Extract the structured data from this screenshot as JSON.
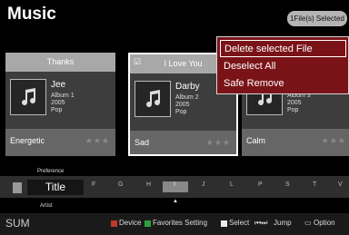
{
  "header": {
    "title": "Music",
    "selected_badge": "1File(s) Selected"
  },
  "cards": [
    {
      "header": "Thanks",
      "artist": "Jee",
      "album": "Album 1",
      "year": "2005",
      "genre": "Pop",
      "mood": "Energetic",
      "stars": "★★★"
    },
    {
      "header": "I Love You",
      "artist": "Darby",
      "album": "Album 2",
      "year": "2005",
      "genre": "Pop",
      "mood": "Sad",
      "stars": "★★★",
      "checked": "☑"
    },
    {
      "header": "",
      "artist": "",
      "album": "Album 3",
      "year": "2005",
      "genre": "Pop",
      "mood": "Calm",
      "stars": "★★★"
    }
  ],
  "context_menu": [
    "Delete selected File",
    "Deselect All",
    "Safe Remove"
  ],
  "sort_bar": {
    "above_label": "Preference",
    "current": "Title",
    "below_label": "Artist",
    "letters": [
      "F",
      "G",
      "H",
      "I",
      "J",
      "L",
      "P",
      "S",
      "T",
      "V"
    ]
  },
  "footer": {
    "left": "SUM",
    "items": [
      "Device",
      "Favorites Setting",
      "Select",
      "Jump",
      "Option"
    ]
  },
  "colors": {
    "menu_bg": "#7a1318",
    "device_key": "#c0392b",
    "favorites_key": "#2e9e3d"
  }
}
